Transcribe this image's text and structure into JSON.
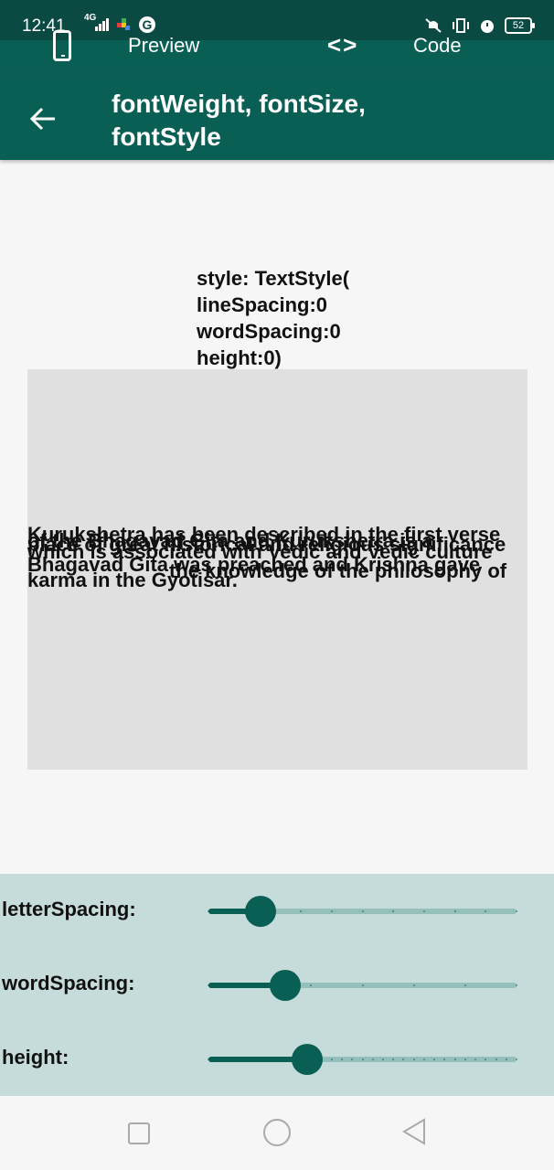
{
  "status": {
    "time": "12:41",
    "network": "4G",
    "battery": "52"
  },
  "tabs": {
    "preview_label": "Preview",
    "code_label": "Code"
  },
  "appbar": {
    "title_line1": "fontWeight, fontSize,",
    "title_line2": "fontStyle"
  },
  "caption": {
    "line1": "style: TextStyle(",
    "line2": "lineSpacing:0",
    "line3": "wordSpacing:0",
    "line4": "height:0)"
  },
  "preview": {
    "lines": [
      "Kurukshetra has been described in the first verse",
      "of the Bhagavad Gita and Kurukshetra is a",
      "place of great historical and religious significance",
      "which is associated with Vedic and Vedic culture",
      "Bhagavad Gita was preached and Krishna gave",
      "the knowledge of the philosophy of",
      "karma in the Gyotisar."
    ]
  },
  "sliders": [
    {
      "label": "letterSpacing:",
      "value": 0.17,
      "divisions": 10
    },
    {
      "label": "wordSpacing:",
      "value": 0.25,
      "divisions": 6
    },
    {
      "label": "height:",
      "value": 0.32,
      "divisions": 30
    }
  ],
  "colors": {
    "primary": "#0a5f55",
    "statusbar": "#0b4a43",
    "panel": "#c6dcdb",
    "preview_bg": "#e0e0e0",
    "track_inactive": "#94bfba"
  },
  "icons": [
    "phone-icon",
    "code-icon",
    "back-arrow-icon",
    "signal-icon",
    "puzzle-icon",
    "google-icon",
    "battery-icon"
  ]
}
